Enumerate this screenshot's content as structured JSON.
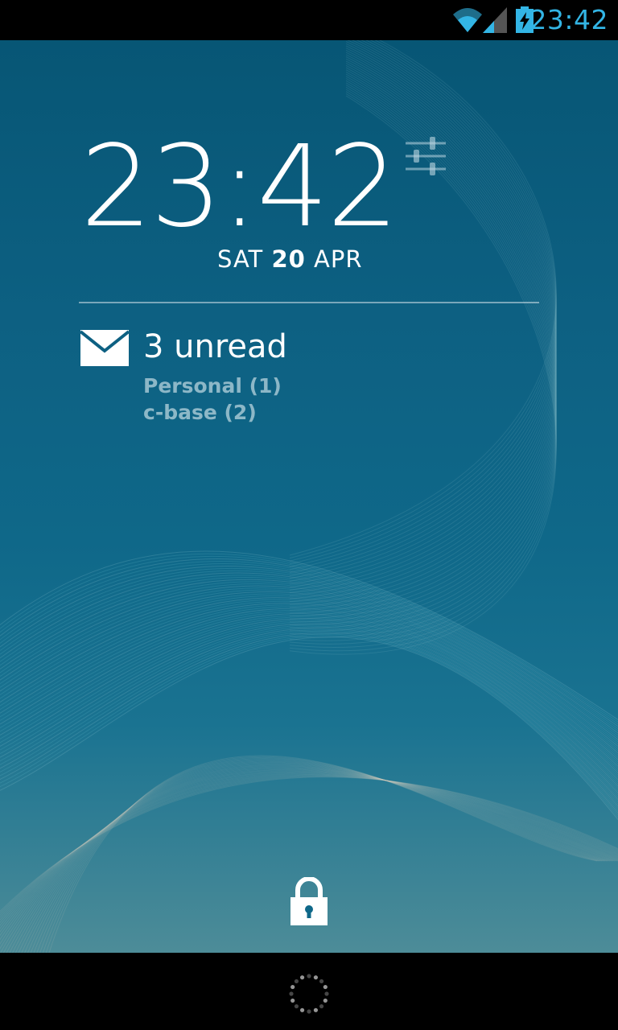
{
  "status_bar": {
    "time": "23:42",
    "icons": [
      "wifi-icon",
      "signal-icon",
      "battery-charging-icon"
    ],
    "accent_color": "#33b5e5"
  },
  "lockscreen": {
    "clock": {
      "time": "23:42",
      "day": "SAT",
      "date_number": "20",
      "month": "APR"
    },
    "widget_settings_icon": "sliders-icon",
    "mail_widget": {
      "icon": "mail-icon",
      "title": "3 unread",
      "accounts": [
        "Personal (1)",
        "c-base (2)"
      ]
    },
    "unlock_icon": "lock-icon"
  },
  "navigation_bar": {
    "icon": "loading-spinner-icon"
  },
  "colors": {
    "wallpaper_top": "#075675",
    "wallpaper_bottom": "#4d8c98",
    "text_primary": "#ffffff"
  }
}
